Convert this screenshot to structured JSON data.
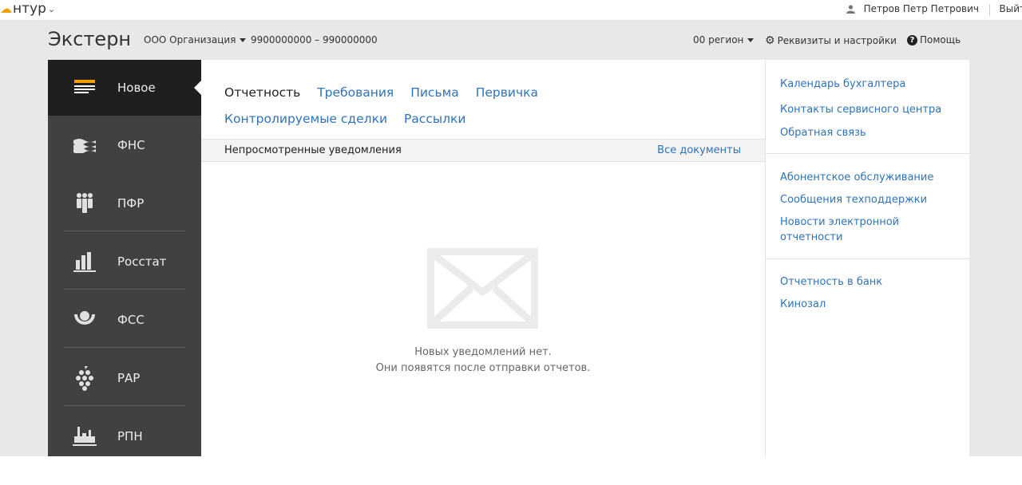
{
  "topbar": {
    "brand": "нтур",
    "user_name": "Петров Петр Петрович",
    "logout": "Выйт"
  },
  "header": {
    "app_title": "Экстерн",
    "organization": "ООО Организация",
    "inn_kpp": "9900000000 – 990000000",
    "region": "00 регион",
    "settings": "Реквизиты и настройки",
    "help": "Помощь"
  },
  "sidebar": {
    "items": [
      {
        "label": "Новое",
        "icon": "new-icon"
      },
      {
        "label": "ФНС",
        "icon": "fns-icon"
      },
      {
        "label": "ПФР",
        "icon": "pfr-icon"
      },
      {
        "label": "Росстат",
        "icon": "rosstat-icon"
      },
      {
        "label": "ФСС",
        "icon": "fss-icon"
      },
      {
        "label": "РАР",
        "icon": "rar-icon"
      },
      {
        "label": "РПН",
        "icon": "rpn-icon"
      }
    ]
  },
  "main": {
    "tabs": [
      {
        "label": "Отчетность"
      },
      {
        "label": "Требования"
      },
      {
        "label": "Письма"
      },
      {
        "label": "Первичка"
      },
      {
        "label": "Контролируемые сделки"
      },
      {
        "label": "Рассылки"
      }
    ],
    "section_title": "Непросмотренные уведомления",
    "all_docs": "Все документы",
    "empty_line1": "Новых уведомлений нет.",
    "empty_line2": "Они появятся после отправки отчетов."
  },
  "right": {
    "group1": [
      "Календарь бухгалтера",
      "Контакты сервисного центра",
      "Обратная связь"
    ],
    "group2": [
      "Абонентское обслуживание",
      "Сообщения техподдержки",
      "Новости электронной отчетности"
    ],
    "group3": [
      "Отчетность в банк",
      "Кинозал"
    ]
  },
  "colors": {
    "link": "#2e73b9",
    "sidebar_bg": "#414141",
    "sidebar_active": "#1f1f1f",
    "accent": "#f2a000",
    "header_bg": "#e8e8e8"
  }
}
